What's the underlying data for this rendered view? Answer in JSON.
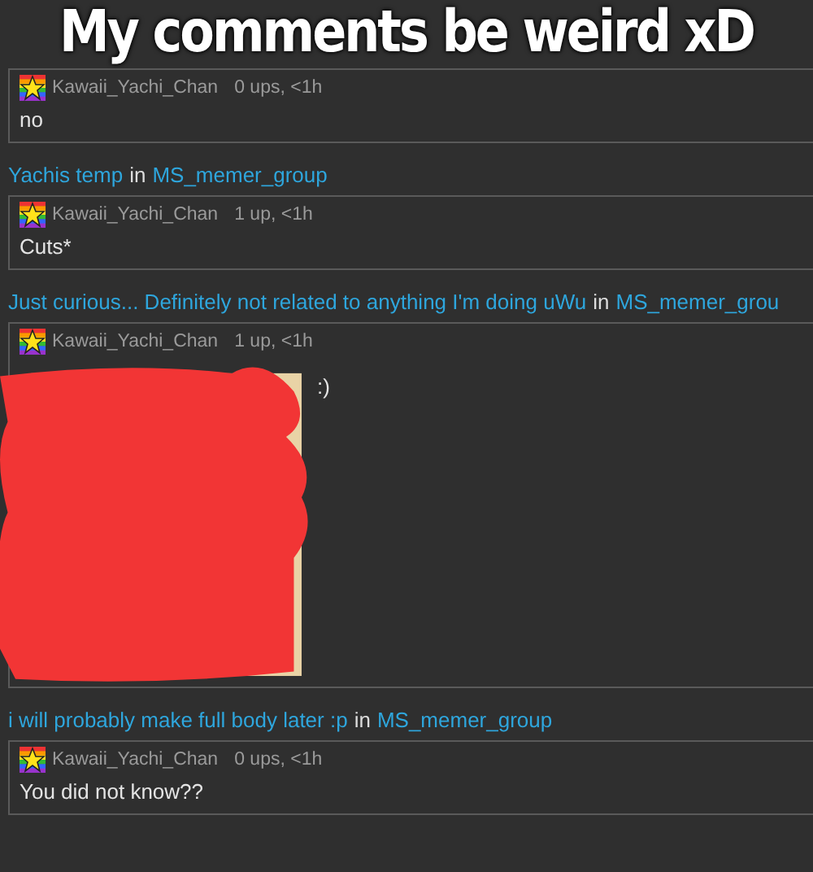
{
  "caption": "My comments be weird xD",
  "posts": [
    {
      "kind": "text",
      "author": "Kawaii_Yachi_Chan",
      "meta": "0 ups, <1h",
      "body": "no"
    },
    {
      "kind": "text",
      "title": "Yachis temp",
      "connector": "in",
      "group": "MS_memer_group",
      "author": "Kawaii_Yachi_Chan",
      "meta": "1 up, <1h",
      "body": "Cuts*"
    },
    {
      "kind": "scribbled",
      "title": "Just curious... Definitely not related to anything I'm doing uWu",
      "connector": "in",
      "group": "MS_memer_grou",
      "author": "Kawaii_Yachi_Chan",
      "meta": "1 up, <1h",
      "body": ":)"
    },
    {
      "kind": "text",
      "title": "i will probably make full body later :p",
      "connector": "in",
      "group": "MS_memer_group",
      "author": "Kawaii_Yachi_Chan",
      "meta": "0 ups, <1h",
      "body": "You did not know??"
    }
  ]
}
